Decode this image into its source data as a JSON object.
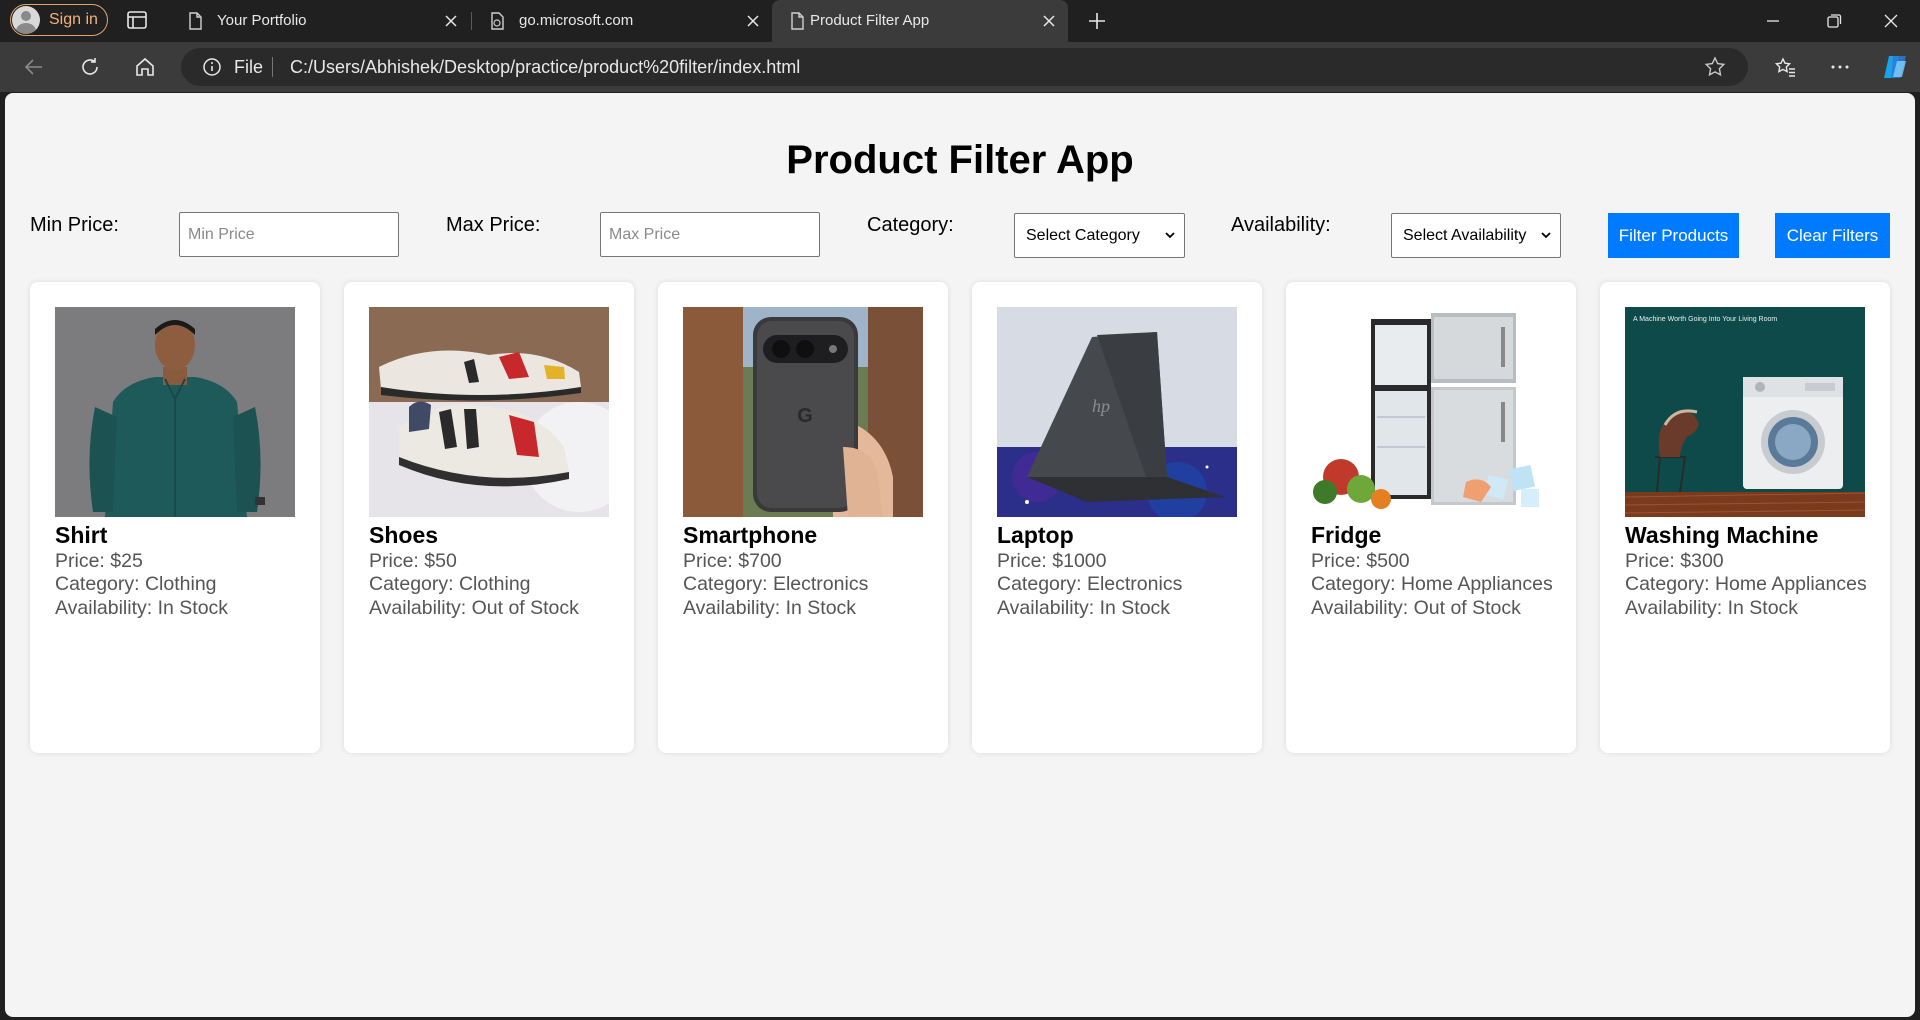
{
  "browser": {
    "signin_label": "Sign in",
    "tabs": [
      {
        "title": "Your Portfolio"
      },
      {
        "title": "go.microsoft.com"
      },
      {
        "title": "Product Filter App"
      }
    ],
    "address": {
      "scheme_label": "File",
      "url": "C:/Users/Abhishek/Desktop/practice/product%20filter/index.html"
    }
  },
  "page": {
    "title": "Product Filter App",
    "filters": {
      "min_price_label": "Min Price:",
      "min_price_placeholder": "Min Price",
      "max_price_label": "Max Price:",
      "max_price_placeholder": "Max Price",
      "category_label": "Category:",
      "category_selected": "Select Category",
      "availability_label": "Availability:",
      "availability_selected": "Select Availability",
      "filter_button": "Filter Products",
      "clear_button": "Clear Filters"
    },
    "colors": {
      "primary_button": "#007bff",
      "page_background": "#f4f4f4"
    },
    "products": [
      {
        "name": "Shirt",
        "price": "Price: $25",
        "category": "Category: Clothing",
        "availability": "Availability: In Stock"
      },
      {
        "name": "Shoes",
        "price": "Price: $50",
        "category": "Category: Clothing",
        "availability": "Availability: Out of Stock"
      },
      {
        "name": "Smartphone",
        "price": "Price: $700",
        "category": "Category: Electronics",
        "availability": "Availability: In Stock"
      },
      {
        "name": "Laptop",
        "price": "Price: $1000",
        "category": "Category: Electronics",
        "availability": "Availability: In Stock"
      },
      {
        "name": "Fridge",
        "price": "Price: $500",
        "category": "Category: Home Appliances",
        "availability": "Availability: Out of Stock"
      },
      {
        "name": "Washing Machine",
        "price": "Price: $300",
        "category": "Category: Home Appliances",
        "availability": "Availability: In Stock",
        "ad_text": "A Machine Worth Going Into Your Living Room"
      }
    ]
  }
}
